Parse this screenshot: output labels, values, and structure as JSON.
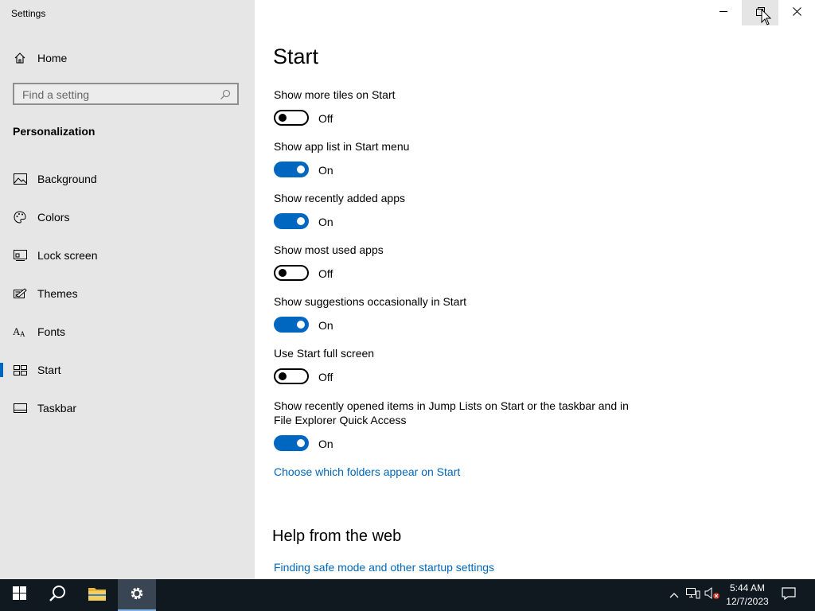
{
  "window": {
    "title": "Settings"
  },
  "sidebar": {
    "home_label": "Home",
    "search_placeholder": "Find a setting",
    "section_title": "Personalization",
    "items": [
      {
        "label": "Background",
        "icon": "picture-icon"
      },
      {
        "label": "Colors",
        "icon": "palette-icon"
      },
      {
        "label": "Lock screen",
        "icon": "lock-screen-icon"
      },
      {
        "label": "Themes",
        "icon": "themes-icon"
      },
      {
        "label": "Fonts",
        "icon": "fonts-icon"
      },
      {
        "label": "Start",
        "icon": "start-tiles-icon",
        "selected": true
      },
      {
        "label": "Taskbar",
        "icon": "taskbar-icon"
      }
    ]
  },
  "main": {
    "title": "Start",
    "settings": [
      {
        "label": "Show more tiles on Start",
        "on": false,
        "state": "Off"
      },
      {
        "label": "Show app list in Start menu",
        "on": true,
        "state": "On"
      },
      {
        "label": "Show recently added apps",
        "on": true,
        "state": "On"
      },
      {
        "label": "Show most used apps",
        "on": false,
        "state": "Off"
      },
      {
        "label": "Show suggestions occasionally in Start",
        "on": true,
        "state": "On"
      },
      {
        "label": "Use Start full screen",
        "on": false,
        "state": "Off"
      },
      {
        "label": "Show recently opened items in Jump Lists on Start or the taskbar and in File Explorer Quick Access",
        "on": true,
        "state": "On"
      }
    ],
    "folders_link": "Choose which folders appear on Start",
    "help_title": "Help from the web",
    "help_link": "Finding safe mode and other startup settings"
  },
  "taskbar": {
    "time": "5:44 AM",
    "date": "12/7/2023"
  },
  "colors": {
    "accent": "#0067c0",
    "link": "#0067b8",
    "sidebar_bg": "#e6e6e6",
    "taskbar_bg": "#101820"
  }
}
